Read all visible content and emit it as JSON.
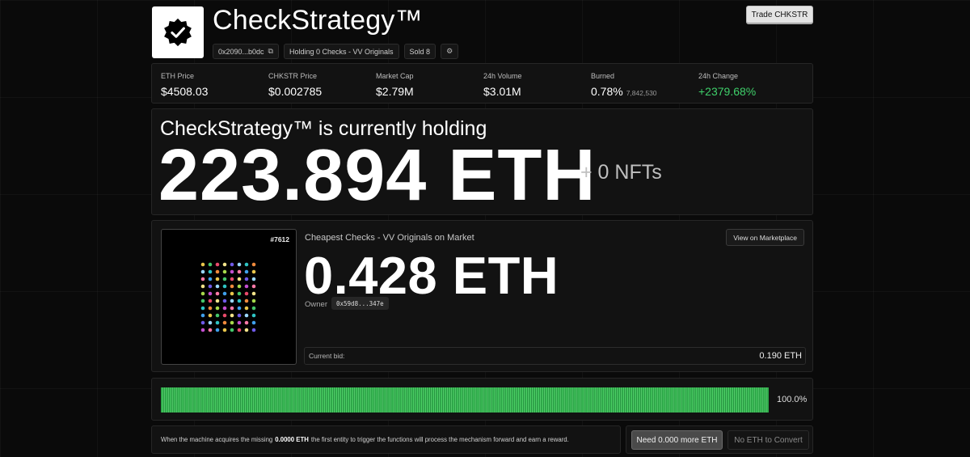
{
  "header": {
    "title": "CheckStrategy™",
    "logo_icon": "verified-check-badge-icon",
    "chips": {
      "address": "0x2090...b0dc",
      "holding": "Holding 0 Checks - VV Originals",
      "sold": "Sold 8",
      "settings_icon": "gear-icon"
    },
    "trade_button": "Trade CHKSTR"
  },
  "stats": {
    "eth_price": {
      "label": "ETH Price",
      "value": "$4508.03"
    },
    "chkstr_price": {
      "label": "CHKSTR Price",
      "value": "$0.002785"
    },
    "market_cap": {
      "label": "Market Cap",
      "value": "$2.79M"
    },
    "volume_24h": {
      "label": "24h Volume",
      "value": "$3.01M"
    },
    "burned": {
      "label": "Burned",
      "value": "0.78%",
      "sub": "7,842,530"
    },
    "change_24h": {
      "label": "24h Change",
      "value": "+2379.68%",
      "color": "#3fcf6a"
    }
  },
  "holding": {
    "title": "CheckStrategy™ is currently holding",
    "amount": "223.894 ETH",
    "nfts": "+ 0 NFTs"
  },
  "market": {
    "nft_id": "#7612",
    "title": "Cheapest Checks - VV Originals on Market",
    "price": "0.428 ETH",
    "owner_label": "Owner",
    "owner": "0x59d8...347e",
    "view_button": "View on Marketplace",
    "bid_label": "Current bid:",
    "bid_value": "0.190 ETH",
    "dot_colors": [
      "#e9c64b",
      "#f08a3c",
      "#e84a6b",
      "#c44fd0",
      "#6f5ae8",
      "#3fa0ec",
      "#2ec4c4",
      "#45c76a",
      "#a7d94b",
      "#f2e38a",
      "#ff7aa8",
      "#9ad8ff"
    ]
  },
  "progress": {
    "percent_value": 1.0,
    "percent_label": "100.0%",
    "color": "#3fcf6a"
  },
  "footer": {
    "note_prefix": "When the machine acquires the missing",
    "note_amount": "0.0000 ETH",
    "note_suffix": "the first entity to trigger the functions will process the mechanism forward and earn a reward.",
    "need_button": "Need 0.000 more ETH",
    "convert_button": "No ETH to Convert"
  }
}
